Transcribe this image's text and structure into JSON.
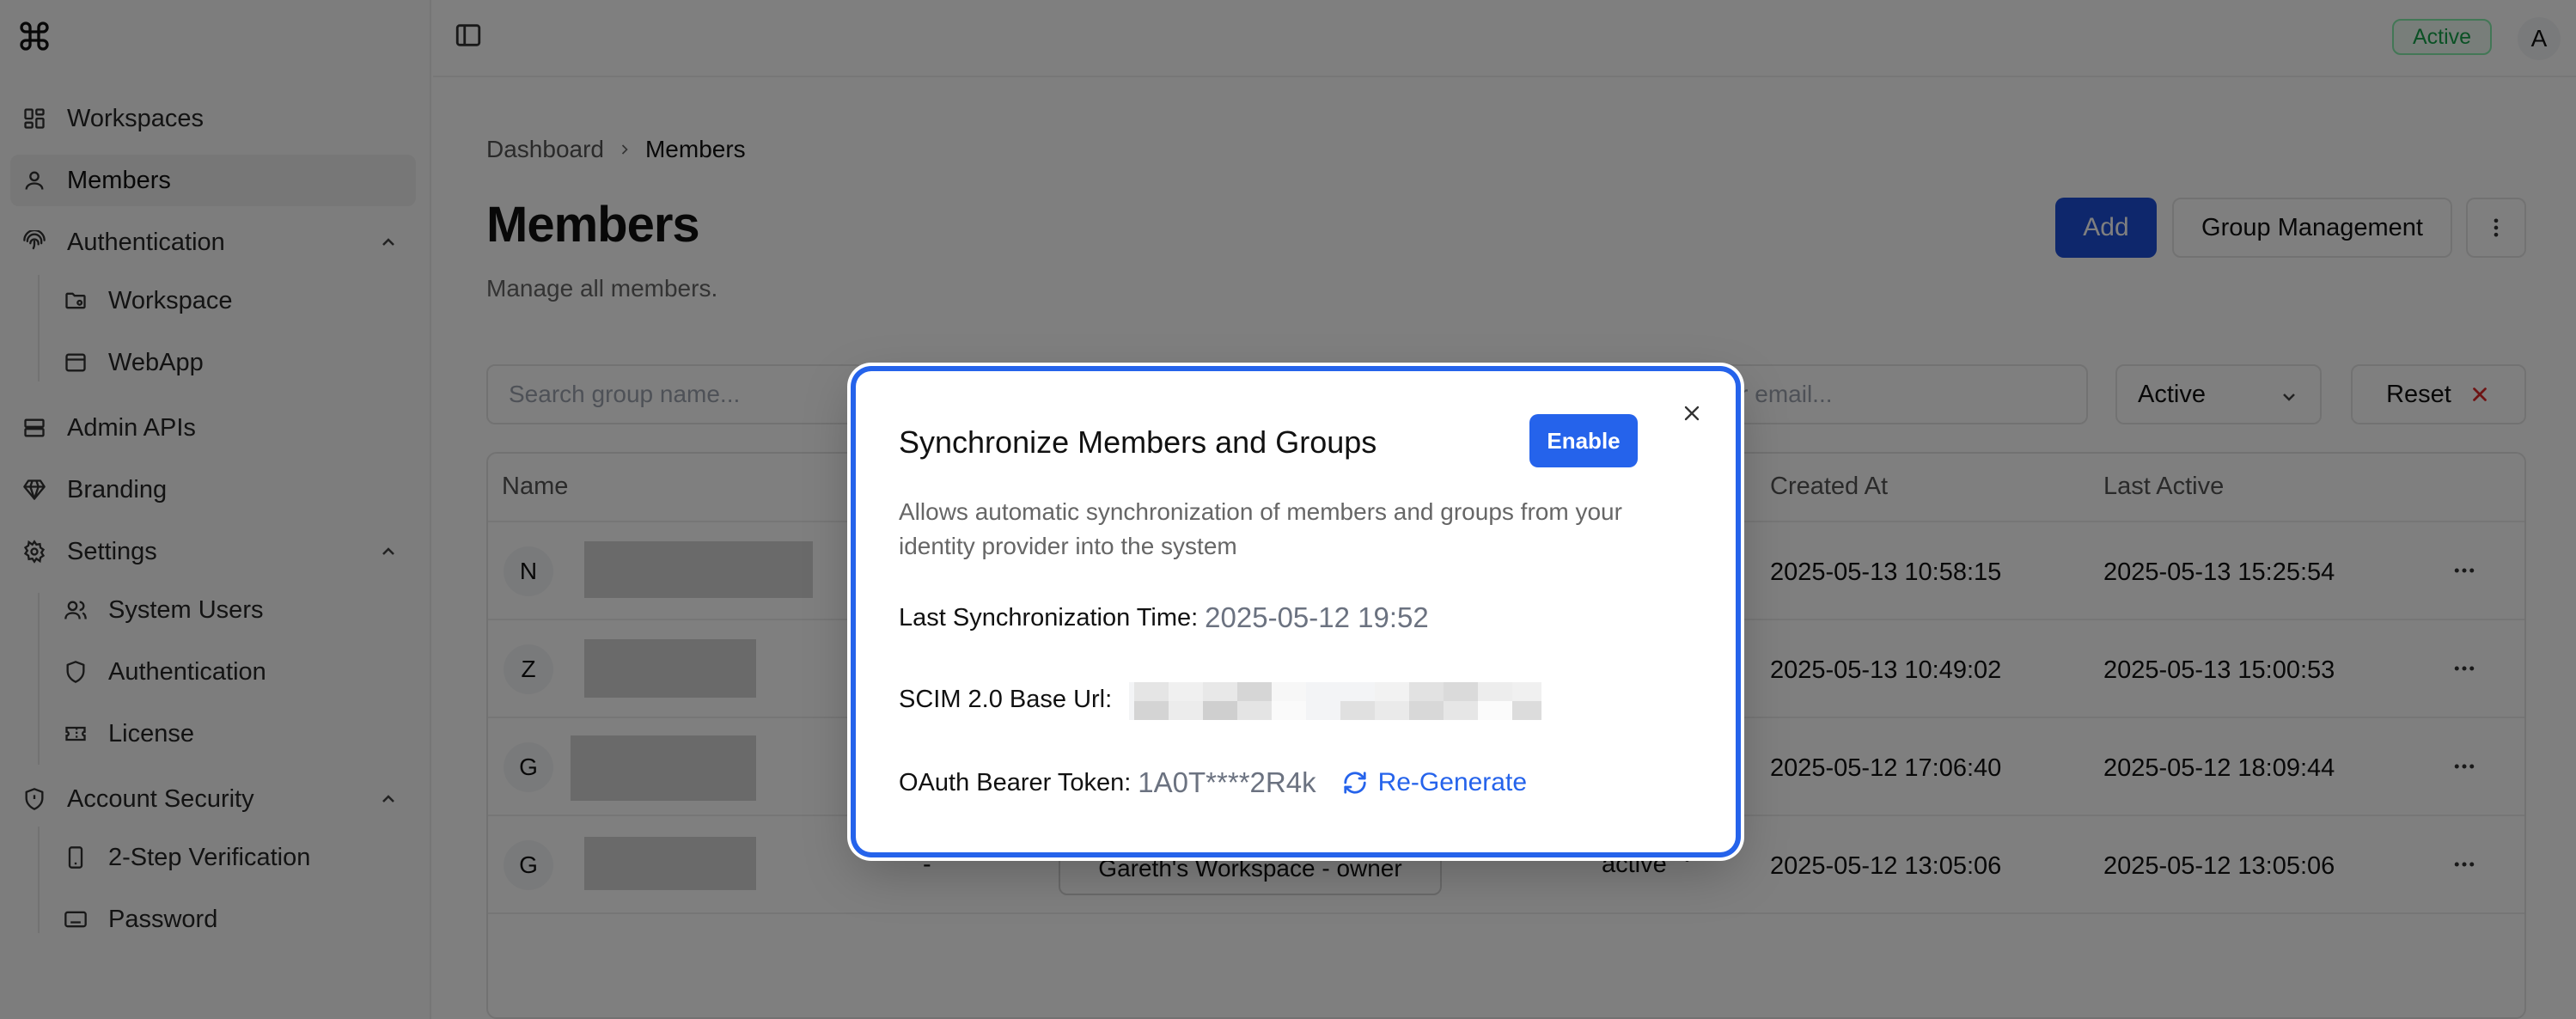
{
  "topbar": {
    "status": "Active",
    "avatar_initial": "A"
  },
  "sidebar": {
    "items": [
      {
        "label": "Workspaces"
      },
      {
        "label": "Members"
      },
      {
        "label": "Authentication"
      },
      {
        "label": "Workspace"
      },
      {
        "label": "WebApp"
      },
      {
        "label": "Admin APIs"
      },
      {
        "label": "Branding"
      },
      {
        "label": "Settings"
      },
      {
        "label": "System Users"
      },
      {
        "label": "Authentication"
      },
      {
        "label": "License"
      },
      {
        "label": "Account Security"
      },
      {
        "label": "2-Step Verification"
      },
      {
        "label": "Password"
      }
    ]
  },
  "page": {
    "breadcrumb": [
      "Dashboard",
      "Members"
    ],
    "title": "Members",
    "subtitle": "Manage all members.",
    "add_label": "Add",
    "group_label": "Group Management"
  },
  "filters": {
    "group_placeholder": "Search group name...",
    "email_placeholder": "ber email...",
    "status_value": "Active",
    "reset_label": "Reset"
  },
  "table": {
    "headers": {
      "name": "Name",
      "created": "Created At",
      "last_active": "Last Active"
    },
    "rows": [
      {
        "initial": "N",
        "created": "2025-05-13 10:58:15",
        "last_active": "2025-05-13 15:25:54"
      },
      {
        "initial": "Z",
        "created": "2025-05-13 10:49:02",
        "last_active": "2025-05-13 15:00:53"
      },
      {
        "initial": "G",
        "created": "2025-05-12 17:06:40",
        "last_active": "2025-05-12 18:09:44"
      },
      {
        "initial": "G",
        "created": "2025-05-12 13:05:06",
        "last_active": "2025-05-12 13:05:06",
        "dash": "-",
        "workspace": "Gareth's Workspace - owner",
        "status": "active"
      }
    ]
  },
  "modal": {
    "title": "Synchronize Members and Groups",
    "enable_label": "Enable",
    "description": "Allows automatic synchronization of members and groups from your identity provider into the system",
    "last_sync_label": "Last Synchronization Time:",
    "last_sync_value": "2025-05-12 19:52",
    "scim_label": "SCIM 2.0 Base Url:",
    "token_label": "OAuth Bearer Token:",
    "token_value": "1A0T****2R4k",
    "regenerate_label": "Re-Generate"
  },
  "colors": {
    "accent": "#2563eb",
    "add_button": "#1d4ed8",
    "status_green": "#16a34a"
  }
}
